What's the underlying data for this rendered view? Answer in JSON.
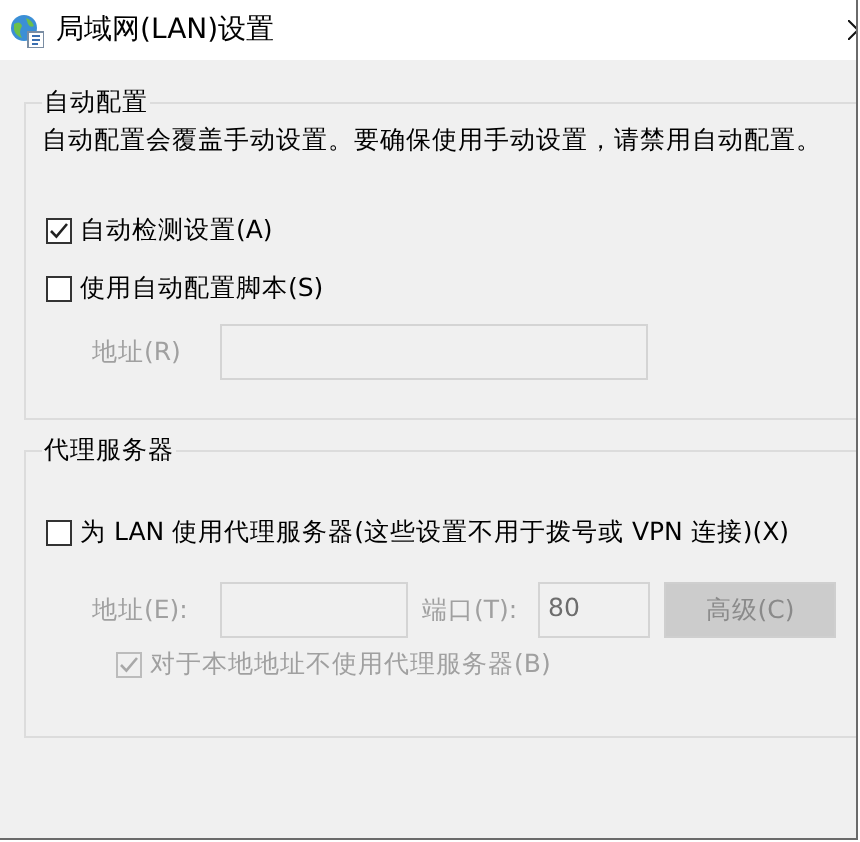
{
  "window": {
    "title": "局域网(LAN)设置"
  },
  "automatic_configuration": {
    "legend": "自动配置",
    "description": "自动配置会覆盖手动设置。要确保使用手动设置，请禁用自动配置。",
    "options": [
      {
        "label": "自动检测设置(A)",
        "checked": true,
        "disabled": false
      },
      {
        "label": "使用自动配置脚本(S)",
        "checked": false,
        "disabled": false
      }
    ],
    "address": {
      "label": "地址(R)",
      "disabled": true
    }
  },
  "proxy_server": {
    "legend": "代理服务器",
    "use_proxy": {
      "label": "为 LAN 使用代理服务器(这些设置不用于拨号或 VPN 连接)(X)",
      "checked": false,
      "disabled": false
    },
    "address": {
      "label": "地址(E):",
      "disabled": true
    },
    "port": {
      "label": "端口(T):",
      "value": "80",
      "disabled": true
    },
    "advanced_button": {
      "label": "高级(C)",
      "disabled": true
    },
    "bypass_local": {
      "label": "对于本地地址不使用代理服务器(B)",
      "checked": true,
      "disabled": true
    }
  }
}
